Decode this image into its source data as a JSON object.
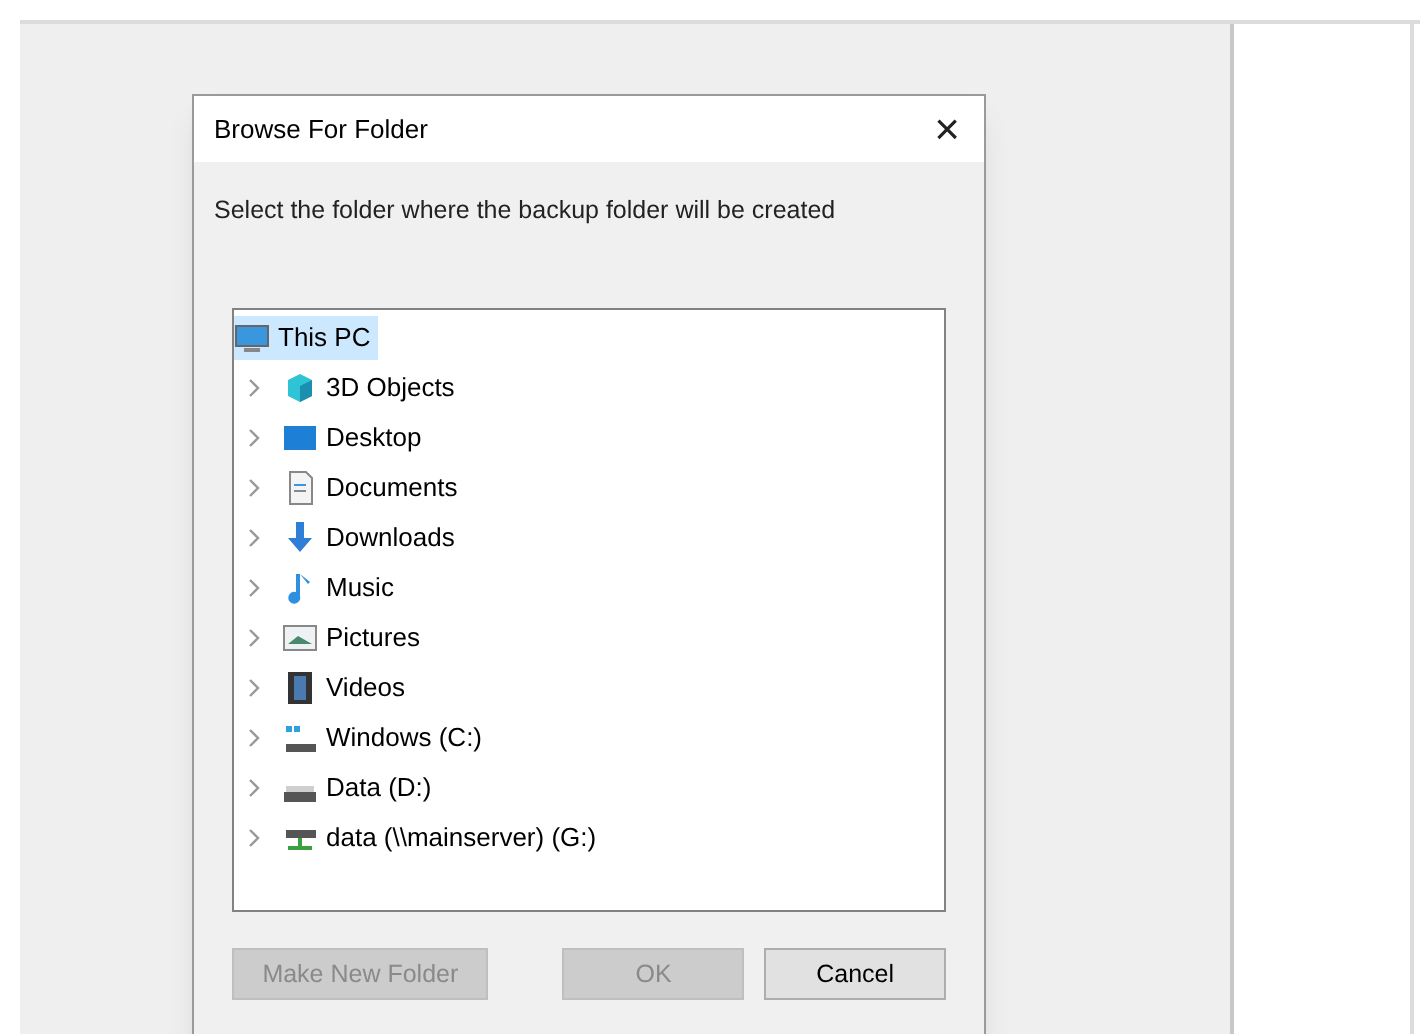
{
  "dialog": {
    "title": "Browse For Folder",
    "close": "×",
    "prompt": "Select the folder where the backup folder will be created",
    "tree": [
      {
        "label": "This PC",
        "kind": "pc",
        "selected": true,
        "children": [
          {
            "label": "3D Objects",
            "kind": "cube",
            "selected": false
          },
          {
            "label": "Desktop",
            "kind": "desktop",
            "selected": false
          },
          {
            "label": "Documents",
            "kind": "document",
            "selected": false
          },
          {
            "label": "Downloads",
            "kind": "download",
            "selected": false
          },
          {
            "label": "Music",
            "kind": "music",
            "selected": false
          },
          {
            "label": "Pictures",
            "kind": "pictures",
            "selected": false
          },
          {
            "label": "Videos",
            "kind": "video",
            "selected": false
          },
          {
            "label": "Windows (C:)",
            "kind": "system-drive",
            "selected": false
          },
          {
            "label": "Data (D:)",
            "kind": "drive",
            "selected": false
          },
          {
            "label": "data (\\\\mainserver) (G:)",
            "kind": "network-drive",
            "selected": false
          }
        ]
      }
    ],
    "buttons": [
      {
        "label": "Make New Folder",
        "disabled": true
      },
      {
        "label": "OK",
        "disabled": true
      },
      {
        "label": "Cancel",
        "disabled": false
      }
    ]
  }
}
